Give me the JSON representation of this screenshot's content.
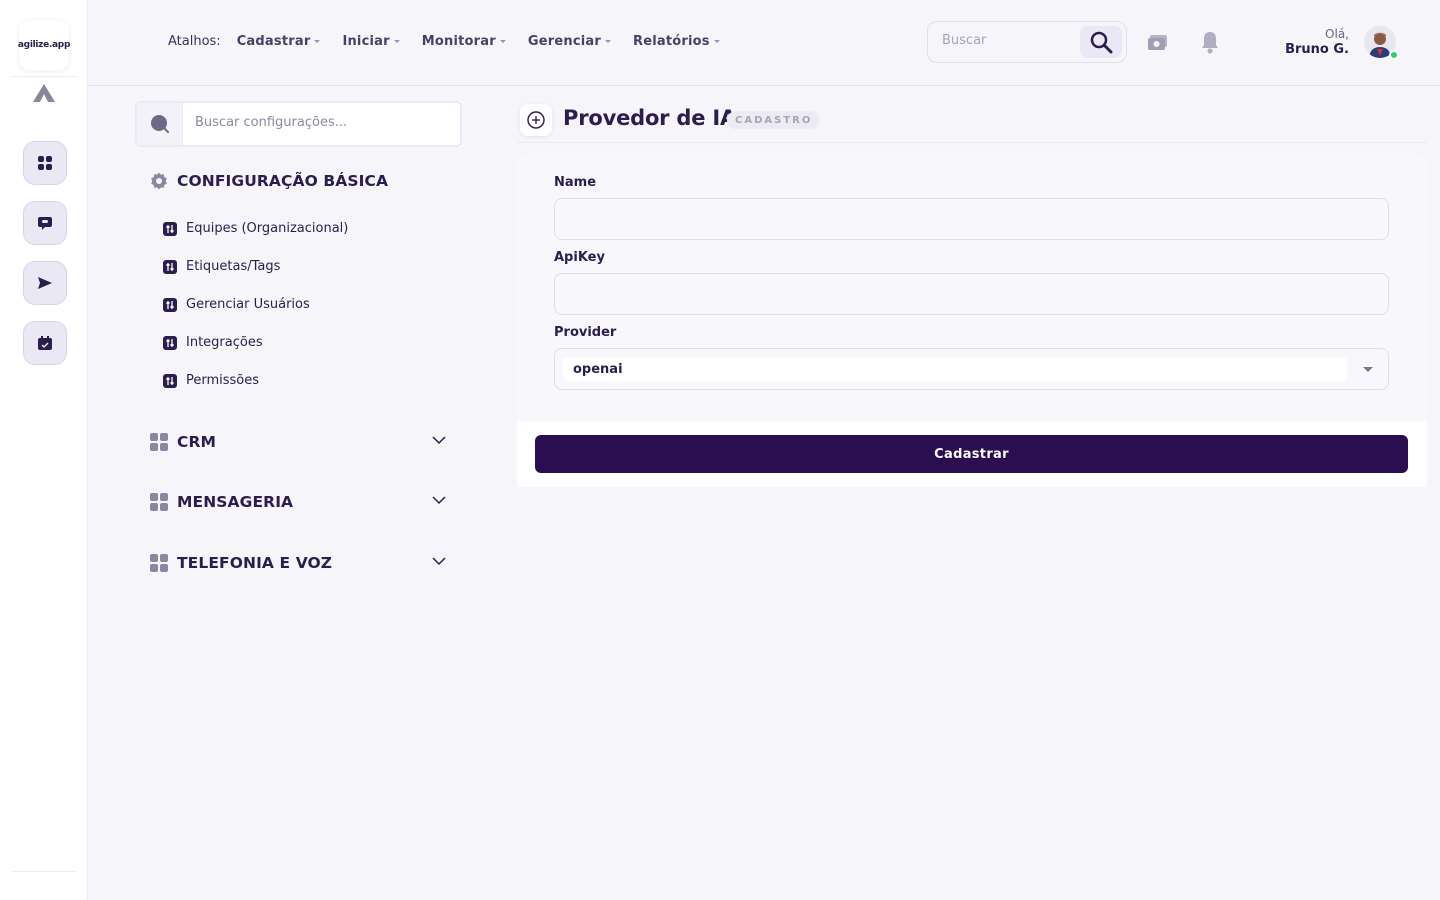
{
  "brand": {
    "logo_text": "agilize.app"
  },
  "header": {
    "shortcuts_label": "Atalhos:",
    "nav": [
      "Cadastrar",
      "Iniciar",
      "Monitorar",
      "Gerenciar",
      "Relatórios"
    ],
    "search_placeholder": "Buscar",
    "greeting": "Olá,",
    "user_name": "Bruno G."
  },
  "settings": {
    "search_placeholder": "Buscar configurações...",
    "basic": {
      "title": "CONFIGURAÇÃO BÁSICA",
      "items": [
        "Equipes (Organizacional)",
        "Etiquetas/Tags",
        "Gerenciar Usuários",
        "Integrações",
        "Permissões"
      ]
    },
    "sections": [
      "CRM",
      "MENSAGERIA",
      "TELEFONIA E VOZ"
    ]
  },
  "page": {
    "title": "Provedor de IA",
    "badge": "CADASTRO"
  },
  "form": {
    "name_label": "Name",
    "name_value": "",
    "apikey_label": "ApiKey",
    "apikey_value": "",
    "provider_label": "Provider",
    "provider_value": "openai",
    "submit_label": "Cadastrar"
  },
  "colors": {
    "primary": "#2b0e4f",
    "text": "#2b1d4e",
    "background": "#f6f5fa",
    "online": "#2fd06b"
  }
}
